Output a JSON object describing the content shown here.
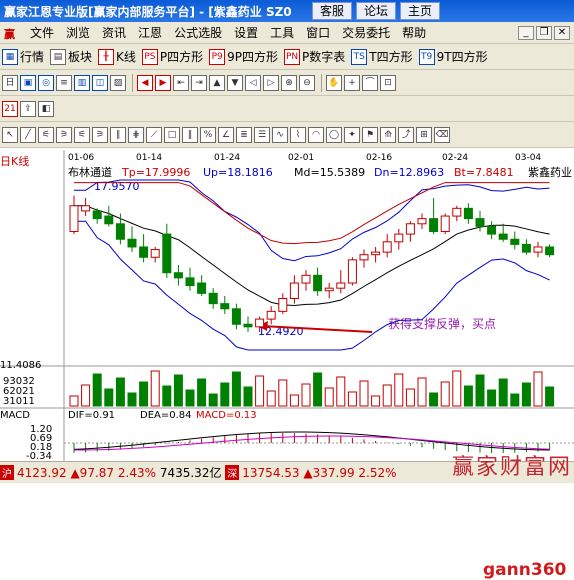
{
  "window": {
    "title": "赢家江恩专业版[赢家内部服务平台] - [紫鑫药业  SZ0",
    "buttons": [
      "客服",
      "论坛",
      "主页"
    ]
  },
  "menu": [
    "文件",
    "浏览",
    "资讯",
    "江恩",
    "公式选股",
    "设置",
    "工具",
    "窗口",
    "交易委托",
    "帮助"
  ],
  "toolbar": {
    "items": [
      "行情",
      "板块",
      "K线",
      "P四方形",
      "9P四方形",
      "P数字表",
      "T四方形",
      "9T四方形"
    ]
  },
  "chart": {
    "period_label": "日K线",
    "dates": [
      "01-06",
      "01-14",
      "01-24",
      "02-01",
      "02-16",
      "02-24",
      "03-04"
    ],
    "indicator_name": "布林通道",
    "tp": "Tp=17.9996",
    "up": "Up=18.1816",
    "md": "Md=15.5389",
    "dn": "Dn=12.8963",
    "bt": "Bt=7.8481",
    "stock_name": "紫鑫药业",
    "high_label": "17.9570",
    "low_label": "12.4920",
    "annotation": "获得支撑反弹，买点",
    "volume_max": "11.4086",
    "volume_ticks": [
      "93032",
      "62021",
      "31011"
    ],
    "macd_title": "MACD",
    "dif": "DIF=0.91",
    "dea": "DEA=0.84",
    "macd": "MACD=0.13",
    "macd_ticks": [
      "1.20",
      "0.69",
      "0.18",
      "-0.34"
    ]
  },
  "chart_data": {
    "type": "candlestick",
    "candles": [
      [
        16.6,
        18.0,
        16.5,
        17.6
      ],
      [
        17.4,
        17.9,
        17.2,
        17.6
      ],
      [
        17.4,
        17.5,
        16.9,
        17.1
      ],
      [
        17.2,
        17.6,
        16.8,
        16.9
      ],
      [
        16.9,
        17.3,
        16.1,
        16.3
      ],
      [
        16.3,
        16.8,
        15.8,
        16.0
      ],
      [
        16.0,
        16.5,
        15.4,
        15.6
      ],
      [
        15.6,
        16.0,
        15.4,
        15.9
      ],
      [
        16.5,
        16.9,
        14.8,
        15.0
      ],
      [
        15.0,
        15.3,
        14.5,
        14.8
      ],
      [
        14.8,
        15.2,
        14.3,
        14.5
      ],
      [
        14.6,
        14.9,
        14.1,
        14.2
      ],
      [
        14.2,
        14.4,
        13.6,
        13.8
      ],
      [
        13.8,
        14.1,
        13.4,
        13.6
      ],
      [
        13.6,
        13.8,
        12.8,
        13.0
      ],
      [
        13.0,
        13.3,
        12.7,
        12.9
      ],
      [
        12.9,
        13.3,
        12.7,
        13.2
      ],
      [
        13.2,
        13.7,
        13.0,
        13.5
      ],
      [
        13.5,
        14.2,
        13.4,
        14.0
      ],
      [
        14.0,
        14.9,
        13.8,
        14.6
      ],
      [
        14.6,
        15.1,
        14.3,
        14.9
      ],
      [
        14.9,
        15.2,
        14.1,
        14.3
      ],
      [
        14.3,
        14.6,
        14.0,
        14.4
      ],
      [
        14.4,
        15.1,
        14.2,
        14.6
      ],
      [
        14.6,
        15.6,
        14.5,
        15.5
      ],
      [
        15.5,
        15.9,
        15.2,
        15.7
      ],
      [
        15.7,
        16.0,
        15.4,
        15.8
      ],
      [
        15.8,
        16.5,
        15.6,
        16.2
      ],
      [
        16.2,
        16.7,
        15.9,
        16.5
      ],
      [
        16.5,
        17.0,
        16.2,
        16.9
      ],
      [
        16.9,
        17.3,
        16.7,
        17.1
      ],
      [
        17.1,
        17.9,
        16.5,
        16.6
      ],
      [
        16.6,
        17.3,
        16.5,
        17.2
      ],
      [
        17.2,
        17.6,
        17.0,
        17.5
      ],
      [
        17.5,
        17.7,
        16.9,
        17.1
      ],
      [
        17.1,
        17.4,
        16.6,
        16.8
      ],
      [
        16.8,
        17.0,
        16.3,
        16.5
      ],
      [
        16.5,
        16.9,
        16.2,
        16.3
      ],
      [
        16.3,
        16.6,
        15.9,
        16.1
      ],
      [
        16.1,
        16.3,
        15.7,
        15.8
      ],
      [
        15.8,
        16.2,
        15.6,
        16.0
      ],
      [
        16.0,
        16.1,
        15.6,
        15.7
      ]
    ],
    "ylim": [
      12.0,
      18.6
    ]
  },
  "status": {
    "sh_index": "4123.92",
    "sh_change": "▲97.87",
    "sh_pct": "2.43%",
    "sh_amount": "7435.32亿",
    "sz_index": "13754.53",
    "sz_change": "▲337.99",
    "sz_pct": "2.52%"
  },
  "watermark": "赢家财富网",
  "gann_logo": "gann",
  "gann_num": "360",
  "colors": {
    "up": "#c00000",
    "down": "#008000",
    "upper_band": "#0000cc",
    "mid": "#000000",
    "lower_band": "#0000cc",
    "tp_line": "#c00000"
  }
}
